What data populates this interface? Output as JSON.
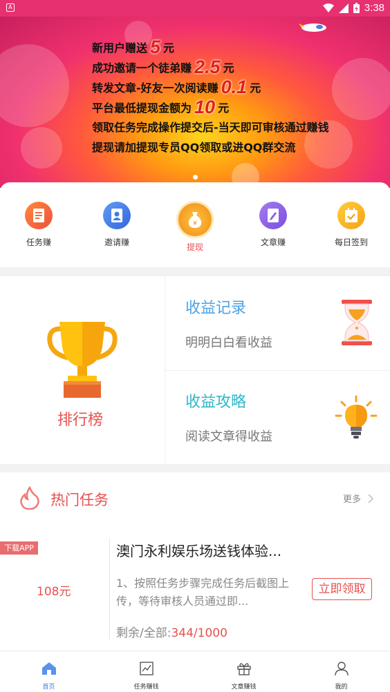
{
  "status_bar": {
    "time": "3:38"
  },
  "banner": {
    "lines": [
      {
        "pre": "新用户赠送",
        "num": "5",
        "post": "元"
      },
      {
        "pre": "成功邀请一个徒弟赚",
        "num": "2.5",
        "post": "元"
      },
      {
        "pre": "转发文章-好友一次阅读赚",
        "num": "0.1",
        "post": "元"
      },
      {
        "pre": "平台最低提现金额为",
        "num": "10",
        "post": "元"
      },
      {
        "pre": "领取任务完成操作提交后-当天即可审核通过赚钱",
        "num": "",
        "post": ""
      },
      {
        "pre": "提现请加提现专员QQ领取或进QQ群交流",
        "num": "",
        "post": ""
      }
    ]
  },
  "quick_menu": [
    {
      "label": "任务赚",
      "icon": "task-icon",
      "color": "#f26a3d"
    },
    {
      "label": "邀请赚",
      "icon": "invite-icon",
      "color": "#3f7be6"
    },
    {
      "label": "提现",
      "icon": "money-bag-icon",
      "color": "#f59b1f"
    },
    {
      "label": "文章赚",
      "icon": "article-icon",
      "color": "#8d5ce8"
    },
    {
      "label": "每日签到",
      "icon": "calendar-check-icon",
      "color": "#f7b323"
    }
  ],
  "earnings": {
    "rank_label": "排行榜",
    "records_title": "收益记录",
    "records_sub": "明明白白看收益",
    "guide_title": "收益攻略",
    "guide_sub": "阅读文章得收益",
    "colors": {
      "records": "#4aa3e8",
      "guide": "#2fb7c9",
      "rank": "#e7504f"
    }
  },
  "hot_tasks": {
    "title": "热门任务",
    "more": "更多",
    "task": {
      "badge": "下载APP",
      "price": "108元",
      "title": "澳门永利娱乐场送钱体验...",
      "desc": "1、按照任务步骤完成任务后截图上传，等待审核人员通过即...",
      "claim": "立即领取",
      "remain_label": "剩余/全部:",
      "remain_value": "344/1000"
    }
  },
  "tabbar": [
    {
      "label": "首页",
      "icon": "home-icon",
      "active": true
    },
    {
      "label": "任务赚钱",
      "icon": "chart-icon",
      "active": false
    },
    {
      "label": "文章赚钱",
      "icon": "gift-icon",
      "active": false
    },
    {
      "label": "我的",
      "icon": "user-icon",
      "active": false
    }
  ]
}
